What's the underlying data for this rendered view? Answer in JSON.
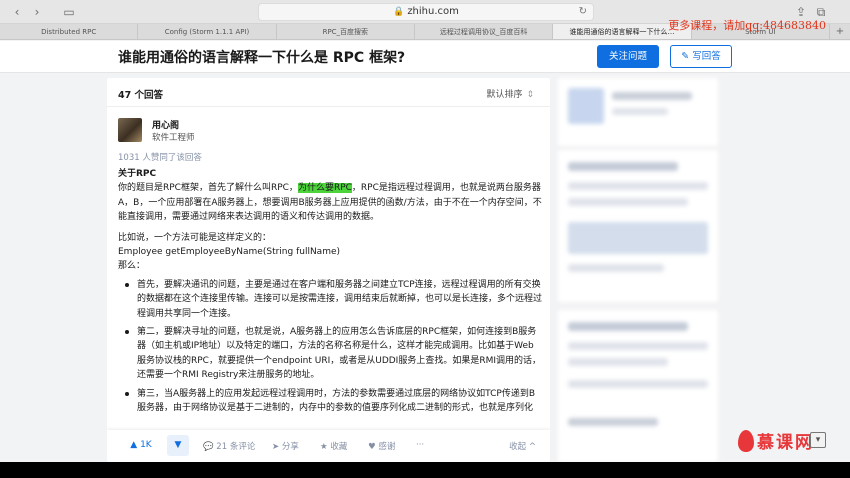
{
  "browser": {
    "url": "zhihu.com",
    "tabs": [
      {
        "label": "Distributed RPC",
        "active": false
      },
      {
        "label": "Config (Storm 1.1.1 API)",
        "active": false
      },
      {
        "label": "RPC_百度搜索",
        "active": false
      },
      {
        "label": "远程过程调用协议_百度百科",
        "active": false
      },
      {
        "label": "谁能用通俗的语言解释一下什么…",
        "active": true
      },
      {
        "label": "Storm UI",
        "active": false
      }
    ]
  },
  "watermark": "更多课程，请加qq:484683840",
  "question": {
    "title": "谁能用通俗的语言解释一下什么是 RPC 框架?",
    "follow_label": "关注问题",
    "answer_label": "写回答"
  },
  "answers": {
    "count_label": "47 个回答",
    "sort_label": "默认排序"
  },
  "answer": {
    "author_name": "用心阁",
    "author_title": "软件工程师",
    "agree_text": "1031 人赞同了该回答",
    "section_title": "关于RPC",
    "para1_a": "你的题目是RPC框架，首先了解什么叫RPC，",
    "para1_hl": "为什么要RPC",
    "para1_b": "，RPC是指远程过程调用，也就是说两台服务器A，B，一个应用部署在A服务器上，想要调用B服务器上应用提供的函数/方法，由于不在一个内存空间，不能直接调用，需要通过网络来表达调用的语义和传达调用的数据。",
    "para2_l1": "比如说，一个方法可能是这样定义的：",
    "para2_l2": "Employee getEmployeeByName(String fullName)",
    "para2_l3": "那么：",
    "bullets": [
      "首先，要解决通讯的问题，主要是通过在客户端和服务器之间建立TCP连接，远程过程调用的所有交换的数据都在这个连接里传输。连接可以是按需连接，调用结束后就断掉，也可以是长连接，多个远程过程调用共享同一个连接。",
      "第二，要解决寻址的问题，也就是说，A服务器上的应用怎么告诉底层的RPC框架，如何连接到B服务器（如主机或IP地址）以及特定的端口，方法的名称名称是什么，这样才能完成调用。比如基于Web服务协议栈的RPC，就要提供一个endpoint URI，或者是从UDDI服务上查找。如果是RMI调用的话，还需要一个RMI Registry来注册服务的地址。",
      "第三，当A服务器上的应用发起远程过程调用时，方法的参数需要通过底层的网络协议如TCP传递到B服务器，由于网络协议是基于二进制的，内存中的参数的值要序列化成二进制的形式，也就是序列化"
    ],
    "vote_count": "1K",
    "comments_label": "21 条评论",
    "share_label": "分享",
    "collect_label": "收藏",
    "thanks_label": "感谢",
    "collapse_label": "收起"
  },
  "brand": {
    "logo_text": "慕课网"
  }
}
